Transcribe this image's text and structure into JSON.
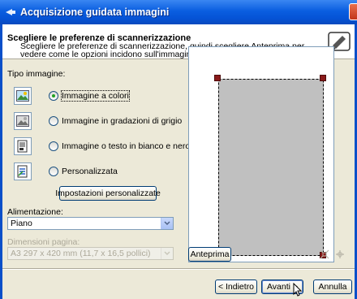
{
  "window": {
    "title": "Acquisizione guidata immagini",
    "accent": "#0a5ee0"
  },
  "header": {
    "title": "Scegliere le preferenze di scannerizzazione",
    "description": "Scegliere le preferenze di scannerizzazione, quindi scegliere Anteprima per vedere come le opzioni incidono sull'immagine."
  },
  "image_type": {
    "label": "Tipo immagine:",
    "options": [
      {
        "label": "Immagine a colori",
        "icon": "color-picture-icon",
        "selected": true
      },
      {
        "label": "Immagine in gradazioni di grigio",
        "icon": "grayscale-picture-icon",
        "selected": false
      },
      {
        "label": "Immagine o testo in bianco e nero",
        "icon": "black-white-text-icon",
        "selected": false
      },
      {
        "label": "Personalizzata",
        "icon": "custom-settings-icon",
        "selected": false
      }
    ],
    "custom_settings_button": "Impostazioni personalizzate"
  },
  "feed": {
    "label": "Alimentazione:",
    "value": "Piano"
  },
  "page_size": {
    "label": "Dimensioni pagina:",
    "value": "A3 297 x 420 mm (11,7 x 16,5 pollici)",
    "enabled": false
  },
  "preview": {
    "button": "Anteprima",
    "page_color": "#c0c0c0"
  },
  "buttons": {
    "back": "< Indietro",
    "next": "Avanti >",
    "cancel": "Annulla"
  }
}
